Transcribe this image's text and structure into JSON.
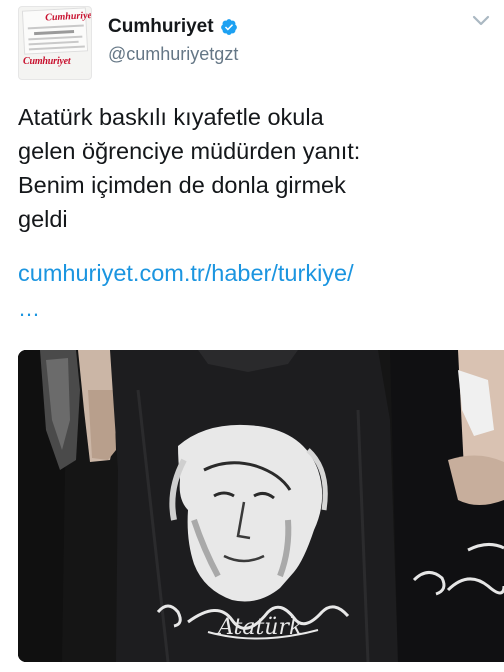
{
  "account": {
    "display_name": "Cumhuriyet",
    "handle": "@cumhuriyetgzt",
    "avatar_masthead": "Cumhuriyet",
    "avatar_brand": "Cumhuriyet"
  },
  "tweet": {
    "text_lines": [
      "Atatürk baskılı kıyafetle okula",
      "gelen öğrenciye müdürden yanıt:",
      "Benim içimden de donla girmek",
      "geldi"
    ],
    "link_text": "cumhuriyet.com.tr/haber/turkiye/",
    "link_ellipsis": "…"
  },
  "media": {
    "shirt_print_text": "Atatürk"
  },
  "icons": {
    "verified": "verified-badge-icon",
    "menu": "chevron-down-icon"
  },
  "colors": {
    "link": "#1b95e0",
    "verified": "#1da1f2",
    "secondary_text": "#657786",
    "brand_red": "#c8102e"
  }
}
